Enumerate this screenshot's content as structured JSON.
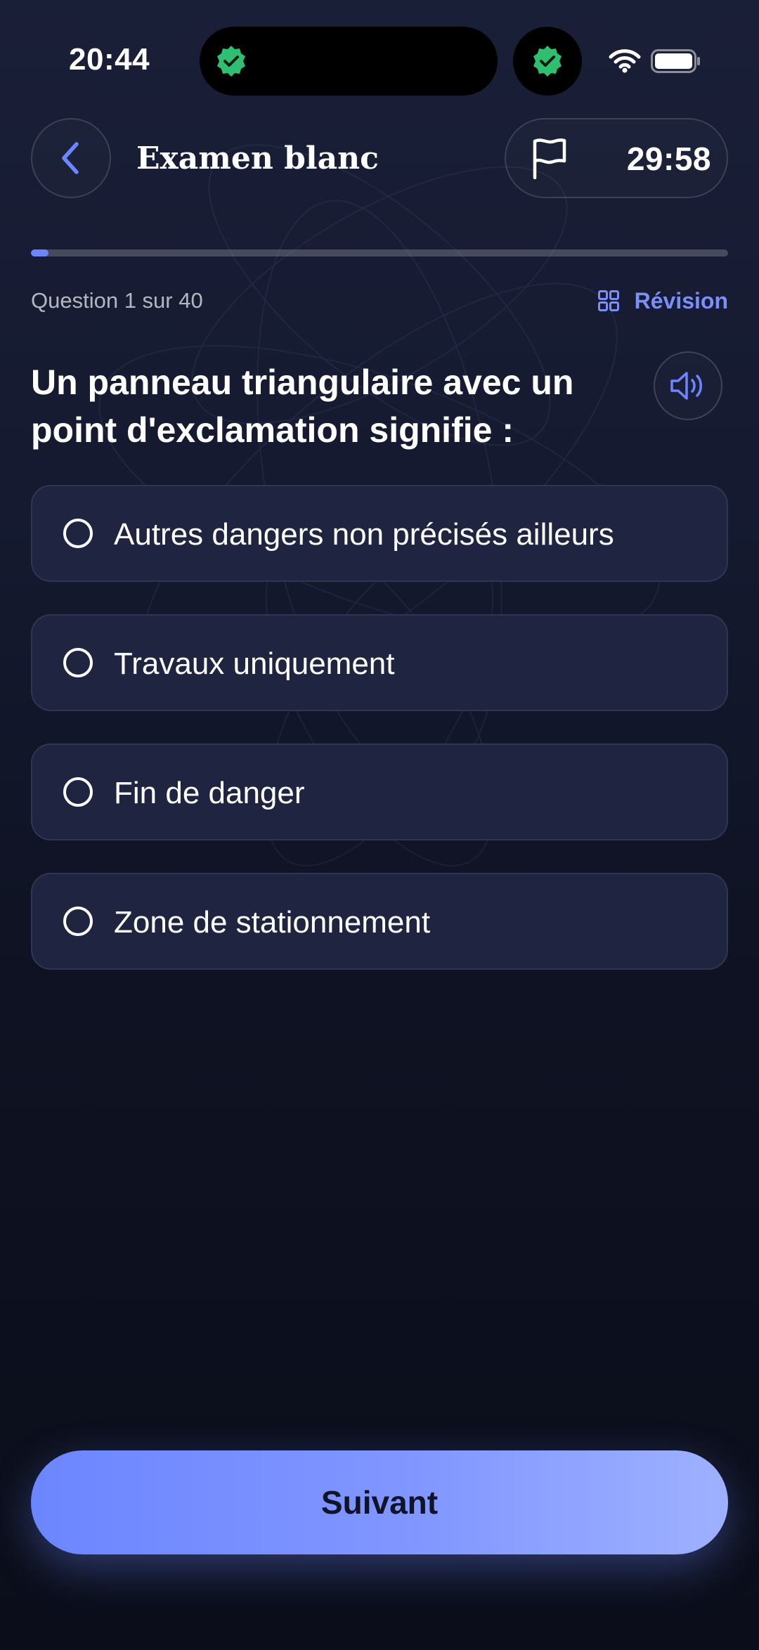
{
  "status_bar": {
    "time": "20:44",
    "icons": [
      "verified-badge-icon",
      "verified-badge-icon",
      "wifi-icon",
      "battery-icon"
    ]
  },
  "header": {
    "back_icon": "chevron-left-icon",
    "title": "Examen blanc",
    "flag_icon": "flag-icon",
    "timer": "29:58"
  },
  "progress": {
    "current": 1,
    "total": 40,
    "fraction": 0.025,
    "label": "Question 1 sur 40"
  },
  "review": {
    "icon": "grid-icon",
    "label": "Révision"
  },
  "question": {
    "text": "Un panneau triangulaire avec un point d'exclamation signifie :",
    "audio_icon": "speaker-icon"
  },
  "options": [
    {
      "label": "Autres dangers non précisés ailleurs",
      "selected": false
    },
    {
      "label": "Travaux uniquement",
      "selected": false
    },
    {
      "label": "Fin de danger",
      "selected": false
    },
    {
      "label": "Zone de stationnement",
      "selected": false
    }
  ],
  "next_button": {
    "label": "Suivant"
  },
  "colors": {
    "accent": "#6d85ff",
    "badge_green": "#2fbf71",
    "card_bg": "#1f2540",
    "background_top": "#1a1f38",
    "background_bottom": "#0b0e1a"
  }
}
